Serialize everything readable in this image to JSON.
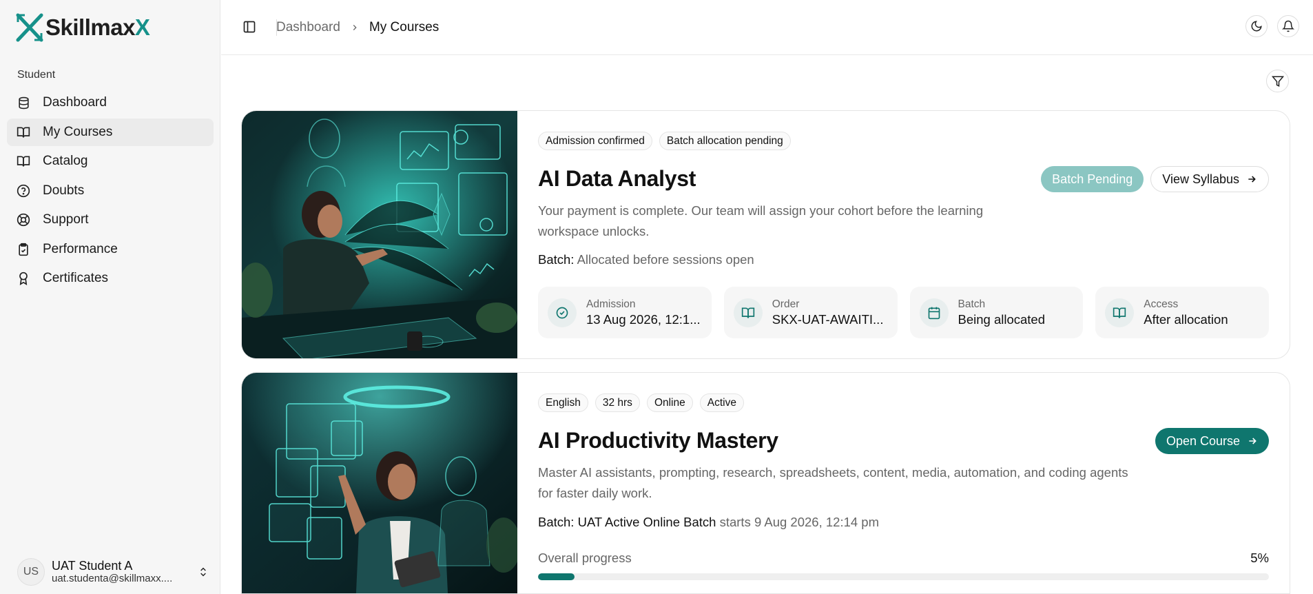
{
  "brand": {
    "name_main": "Skillmax",
    "name_accent": "X",
    "accent_color": "#16918a"
  },
  "sidebar": {
    "section_label": "Student",
    "items": [
      {
        "label": "Dashboard",
        "icon": "database-icon",
        "active": false
      },
      {
        "label": "My Courses",
        "icon": "book-open-icon",
        "active": true
      },
      {
        "label": "Catalog",
        "icon": "book-icon",
        "active": false
      },
      {
        "label": "Doubts",
        "icon": "help-circle-icon",
        "active": false
      },
      {
        "label": "Support",
        "icon": "life-buoy-icon",
        "active": false
      },
      {
        "label": "Performance",
        "icon": "clipboard-check-icon",
        "active": false
      },
      {
        "label": "Certificates",
        "icon": "award-icon",
        "active": false
      }
    ],
    "user": {
      "initials": "US",
      "name": "UAT Student A",
      "email": "uat.studenta@skillmaxx...."
    }
  },
  "header": {
    "breadcrumb": {
      "parent": "Dashboard",
      "current": "My Courses"
    }
  },
  "courses": [
    {
      "badges": [
        "Admission confirmed",
        "Batch allocation pending"
      ],
      "title": "AI Data Analyst",
      "description": "Your payment is complete. Our team will assign your cohort before the learning workspace unlocks.",
      "batch_label": "Batch:",
      "batch_value": "Allocated before sessions open",
      "status_button": "Batch Pending",
      "action_button": "View Syllabus",
      "stats": [
        {
          "label": "Admission",
          "value": "13 Aug 2026, 12:1...",
          "icon": "check-circle-icon"
        },
        {
          "label": "Order",
          "value": "SKX-UAT-AWAITI...",
          "icon": "book-open-icon"
        },
        {
          "label": "Batch",
          "value": "Being allocated",
          "icon": "calendar-icon"
        },
        {
          "label": "Access",
          "value": "After allocation",
          "icon": "book-open-icon"
        }
      ]
    },
    {
      "badges": [
        "English",
        "32 hrs",
        "Online",
        "Active"
      ],
      "title": "AI Productivity Mastery",
      "description": "Master AI assistants, prompting, research, spreadsheets, content, media, automation, and coding agents for faster daily work.",
      "batch_label": "Batch:",
      "batch_name": "UAT Active Online Batch",
      "batch_start": "starts 9 Aug 2026, 12:14 pm",
      "action_button": "Open Course",
      "progress_label": "Overall progress",
      "progress_text": "5%",
      "progress_fraction": 0.05
    }
  ]
}
